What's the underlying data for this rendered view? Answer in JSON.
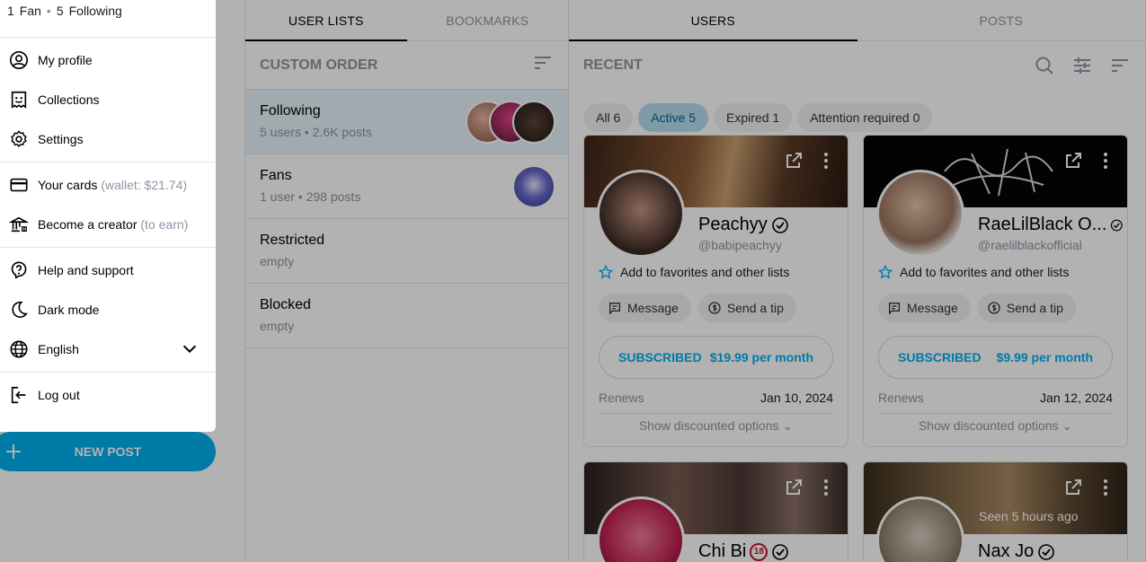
{
  "menu": {
    "fans_count": "1",
    "fans_label": "Fan",
    "following_count": "5",
    "following_label": "Following",
    "items": {
      "my_profile": "My profile",
      "collections": "Collections",
      "settings": "Settings",
      "your_cards": "Your cards",
      "wallet": "(wallet: $21.74)",
      "become_creator": "Become a creator",
      "to_earn": "(to earn)",
      "help": "Help and support",
      "dark_mode": "Dark mode",
      "language": "English",
      "logout": "Log out"
    }
  },
  "new_post": "NEW POST",
  "lists_tabs": [
    "USER LISTS",
    "BOOKMARKS"
  ],
  "users_tabs": [
    "USERS",
    "POSTS"
  ],
  "custom_order": "CUSTOM ORDER",
  "recent": "RECENT",
  "lists": [
    {
      "name": "Following",
      "meta_a": "5 users",
      "meta_b": "2.6K posts"
    },
    {
      "name": "Fans",
      "meta_a": "1 user",
      "meta_b": "298 posts"
    },
    {
      "name": "Restricted",
      "meta": "empty"
    },
    {
      "name": "Blocked",
      "meta": "empty"
    }
  ],
  "chips": [
    "All 6",
    "Active 5",
    "Expired 1",
    "Attention required 0"
  ],
  "cards": [
    {
      "name": "Peachyy",
      "handle": "@babipeachyy",
      "price": "$19.99 per month",
      "renews": "Jan 10, 2024"
    },
    {
      "name": "RaeLilBlack O...",
      "handle": "@raelilblackofficial",
      "price": "$9.99 per month",
      "renews": "Jan 12, 2024"
    },
    {
      "name": "Chi Bi",
      "age": "18"
    },
    {
      "name": "Nax Jo",
      "seen": "Seen 5 hours ago"
    }
  ],
  "card_labels": {
    "favorites": "Add to favorites and other lists",
    "message": "Message",
    "tip": "Send a tip",
    "subscribed": "SUBSCRIBED",
    "renews": "Renews",
    "discount": "Show discounted options"
  },
  "colors": {
    "accent": "#00aff0",
    "selected_chip": "#b7deef"
  }
}
